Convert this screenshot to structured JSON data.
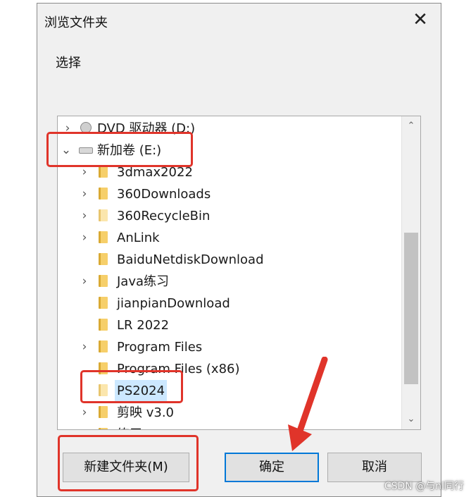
{
  "dialog": {
    "title": "浏览文件夹",
    "close_glyph": "✕",
    "prompt": "选择"
  },
  "tree": {
    "items": [
      {
        "label": "DVD 驱动器 (D:)",
        "expander": "›",
        "icon": "dvd-drive-icon"
      },
      {
        "label": "新加卷 (E:)",
        "expander": "⌄",
        "icon": "drive-icon"
      },
      {
        "label": "3dmax2022",
        "expander": "›",
        "icon": "folder-icon"
      },
      {
        "label": "360Downloads",
        "expander": "›",
        "icon": "folder-icon"
      },
      {
        "label": "360RecycleBin",
        "expander": "›",
        "icon": "folder-icon"
      },
      {
        "label": "AnLink",
        "expander": "›",
        "icon": "folder-icon"
      },
      {
        "label": "BaiduNetdiskDownload",
        "expander": "",
        "icon": "folder-icon"
      },
      {
        "label": "Java练习",
        "expander": "›",
        "icon": "folder-icon"
      },
      {
        "label": "jianpianDownload",
        "expander": "",
        "icon": "folder-icon"
      },
      {
        "label": "LR 2022",
        "expander": "",
        "icon": "folder-icon"
      },
      {
        "label": "Program Files",
        "expander": "›",
        "icon": "folder-icon"
      },
      {
        "label": "Program Files (x86)",
        "expander": "",
        "icon": "folder-icon"
      },
      {
        "label": "PS2024",
        "expander": "",
        "icon": "folder-icon",
        "selected": true
      },
      {
        "label": "剪映 v3.0",
        "expander": "›",
        "icon": "folder-icon"
      },
      {
        "label": "练习",
        "expander": "›",
        "icon": "folder-icon"
      }
    ]
  },
  "scrollbar": {
    "up": "⌃",
    "down": "⌄"
  },
  "buttons": {
    "new_folder": "新建文件夹(M)",
    "ok": "确定",
    "cancel": "取消"
  },
  "watermark": "CSDN @与nl同行",
  "colors": {
    "annotation_red": "#e0342a",
    "selection_blue": "#cce8ff",
    "primary_border": "#0078d7",
    "folder_yellow": "#f6cf6a"
  }
}
